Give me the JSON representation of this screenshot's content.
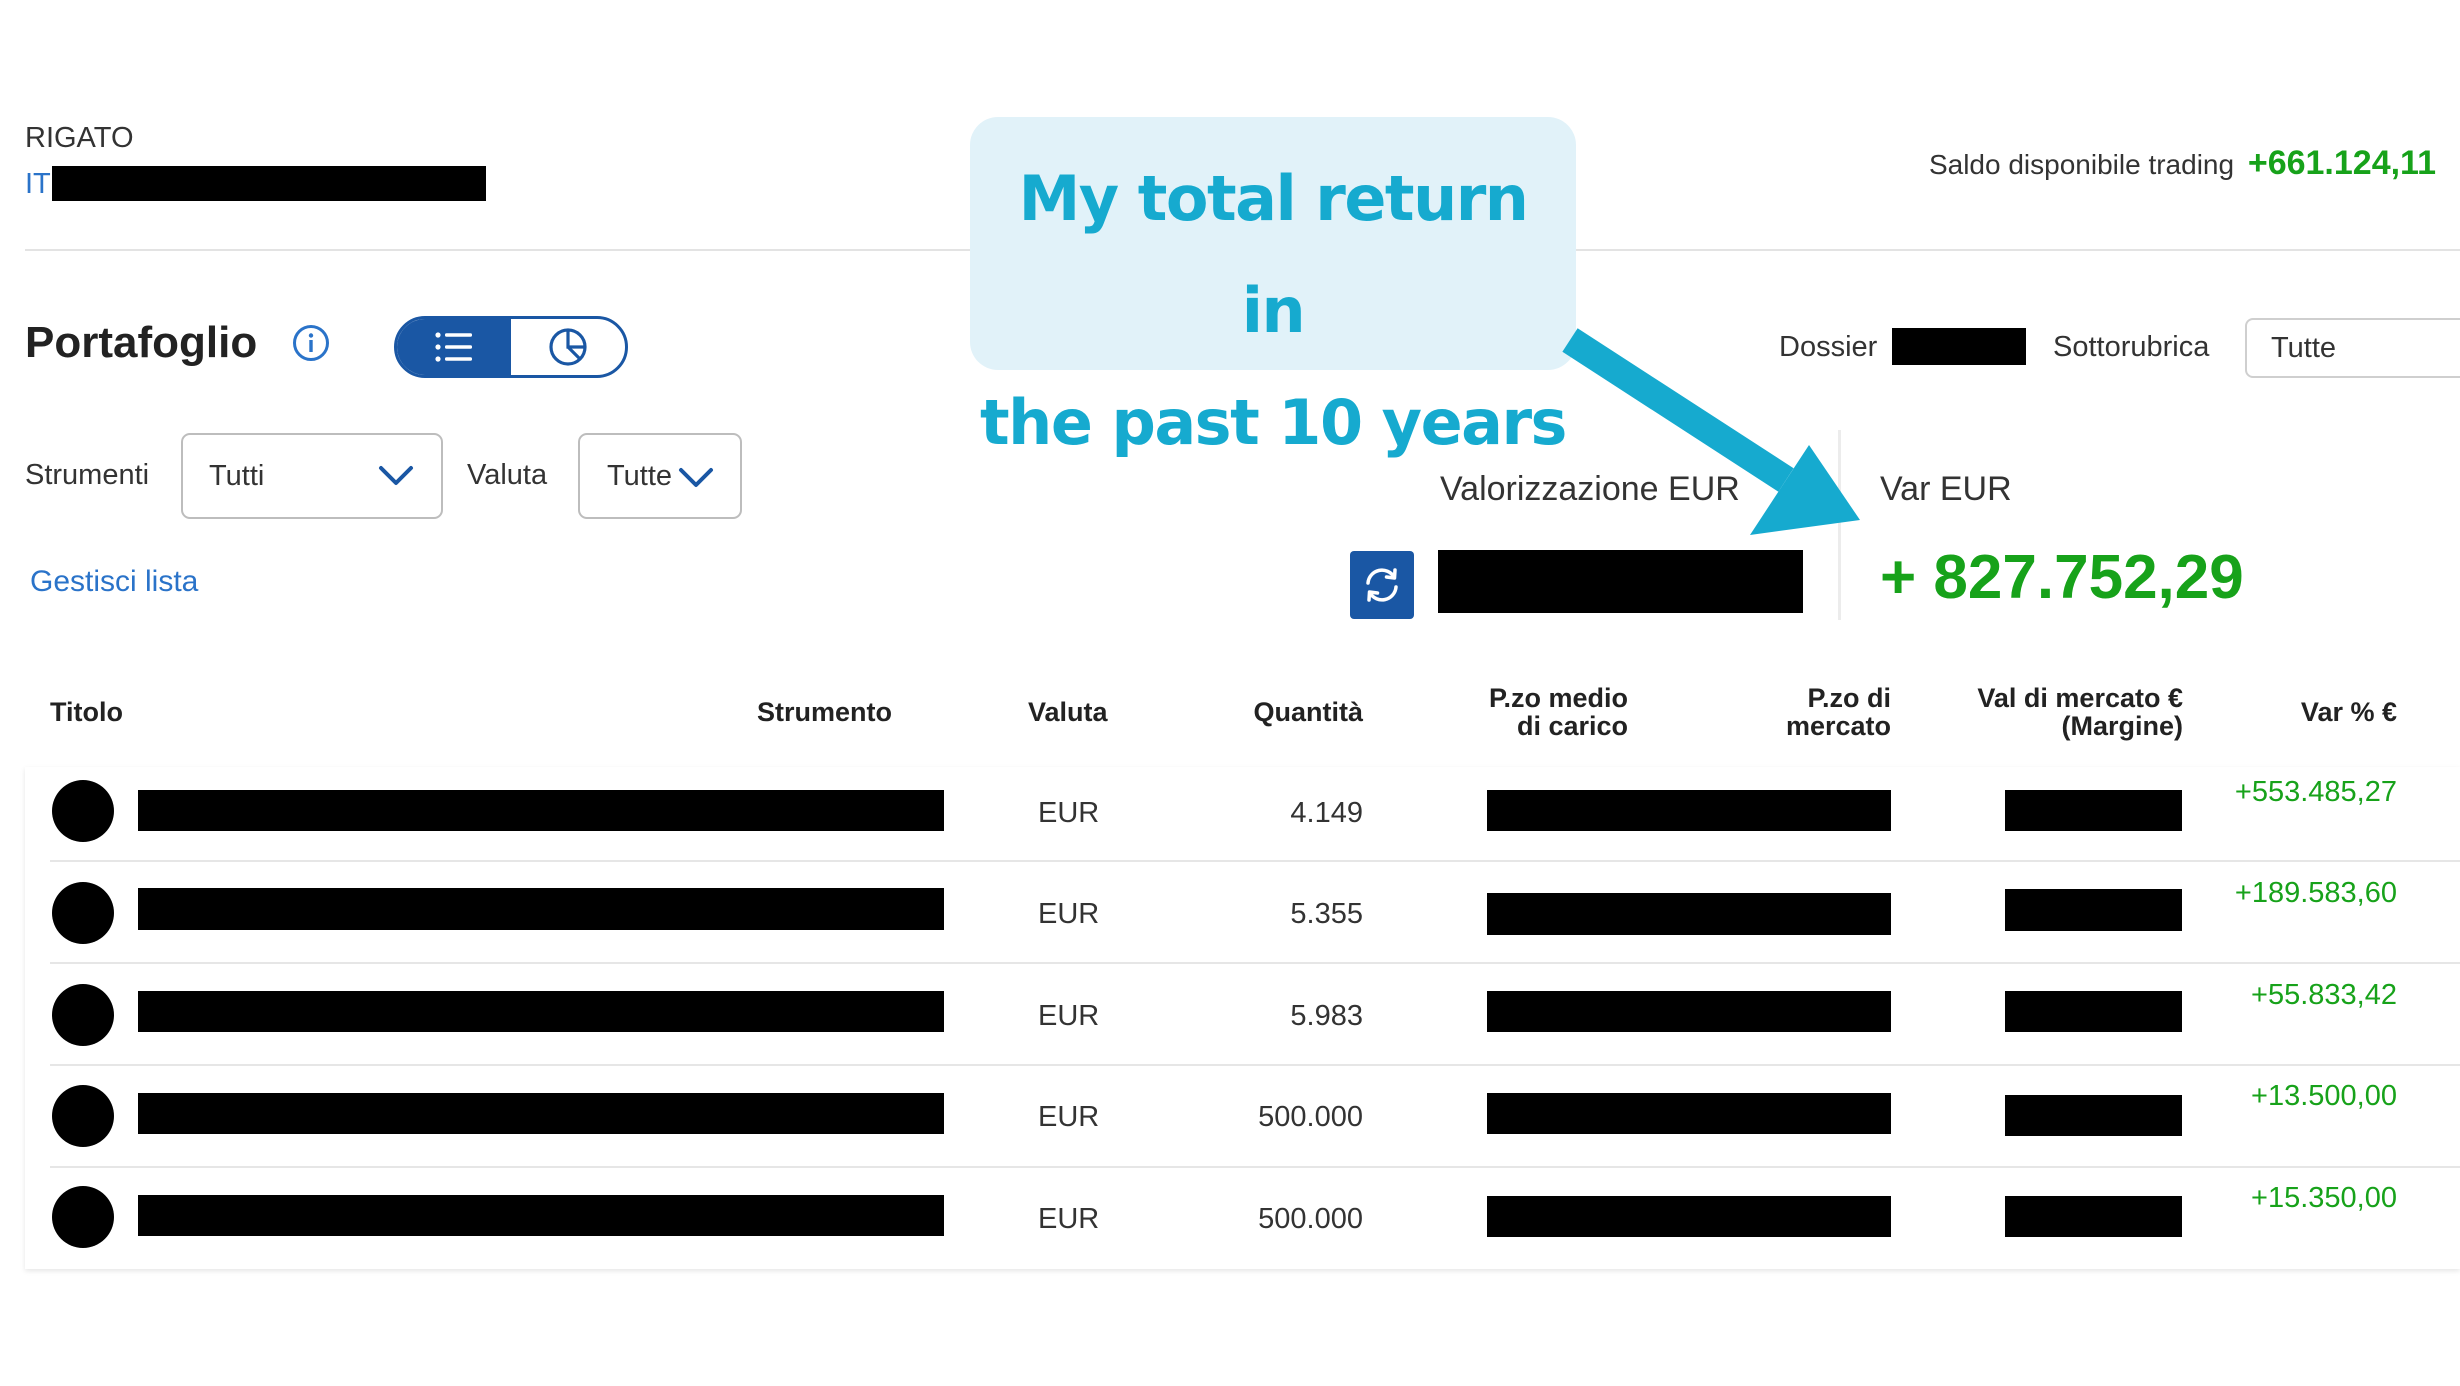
{
  "account": {
    "name": "RIGATO",
    "iban_prefix": "IT"
  },
  "balance": {
    "label": "Saldo disponibile trading",
    "value": "+661.124,11"
  },
  "portfolio": {
    "title": "Portafoglio"
  },
  "dossier": {
    "label": "Dossier",
    "sottorubrica_label": "Sottorubrica",
    "sottorubrica_value": "Tutte"
  },
  "filters": {
    "strumenti_label": "Strumenti",
    "strumenti_value": "Tutti",
    "valuta_label": "Valuta",
    "valuta_value": "Tutte",
    "manage_list": "Gestisci lista"
  },
  "summary": {
    "valorizzazione_label": "Valorizzazione EUR",
    "var_label": "Var EUR",
    "var_value": "+ 827.752,29"
  },
  "callout": {
    "line1": "My total return in",
    "line2": "the past 10 years"
  },
  "table": {
    "headers": {
      "titolo": "Titolo",
      "strumento": "Strumento",
      "valuta": "Valuta",
      "quantita": "Quantità",
      "pzo_medio_1": "P.zo medio",
      "pzo_medio_2": "di carico",
      "pzo_mercato_1": "P.zo di",
      "pzo_mercato_2": "mercato",
      "val_mercato_1": "Val di mercato €",
      "val_mercato_2": "(Margine)",
      "var_pct": "Var % €"
    },
    "rows": [
      {
        "valuta": "EUR",
        "quantita": "4.149",
        "var": "+553.485,27"
      },
      {
        "valuta": "EUR",
        "quantita": "5.355",
        "var": "+189.583,60"
      },
      {
        "valuta": "EUR",
        "quantita": "5.983",
        "var": "+55.833,42"
      },
      {
        "valuta": "EUR",
        "quantita": "500.000",
        "var": "+13.500,00"
      },
      {
        "valuta": "EUR",
        "quantita": "500.000",
        "var": "+15.350,00"
      }
    ]
  },
  "colors": {
    "accent_blue": "#1a57a4",
    "link_blue": "#2a73c9",
    "positive_green": "#17a21a",
    "callout_bg": "#e1f2f9",
    "callout_text": "#16aacf"
  }
}
